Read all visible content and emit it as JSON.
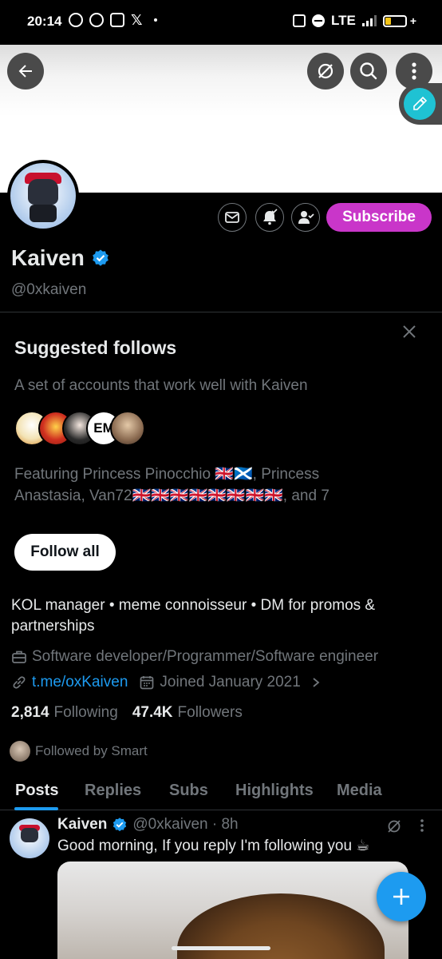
{
  "status_bar": {
    "time": "20:14",
    "network": "LTE",
    "icons": [
      "whatsapp-icon",
      "whatsapp-icon",
      "discord-icon",
      "x-icon",
      "mute-icon",
      "dnd-icon",
      "signal-icon",
      "battery-icon"
    ]
  },
  "profile": {
    "name": "Kaiven",
    "handle": "@0xkaiven",
    "subscribe_label": "Subscribe",
    "bio": "KOL manager • meme connoisseur • DM for promos & partnerships",
    "job": "Software developer/Programmer/Software engineer",
    "link": "t.me/oxKaiven",
    "joined": "Joined January 2021",
    "following_count": "2,814",
    "following_label": "Following",
    "followers_count": "47.4K",
    "followers_label": "Followers",
    "followed_by": "Followed by Smart"
  },
  "suggested": {
    "title": "Suggested follows",
    "subtitle": "A set of accounts that work well with Kaiven",
    "featuring": "Featuring Princess Pinocchio 🇬🇧🏴󠁧󠁢󠁳󠁣󠁴󠁿, Princess Anastasia, Van72🇬🇧🇬🇧🇬🇧🇬🇧🇬🇧🇬🇧🇬🇧🇬🇧, and 7",
    "follow_all_label": "Follow all",
    "avatar_em_text": "EM"
  },
  "tabs": [
    "Posts",
    "Replies",
    "Subs",
    "Highlights",
    "Media"
  ],
  "post": {
    "name": "Kaiven",
    "meta": "@0xkaiven · 8h",
    "text": "Good morning, If you reply I'm following you ☕"
  },
  "colors": {
    "accent": "#1d9bf0",
    "subscribe": "#c936c9",
    "muted": "#71767b"
  }
}
